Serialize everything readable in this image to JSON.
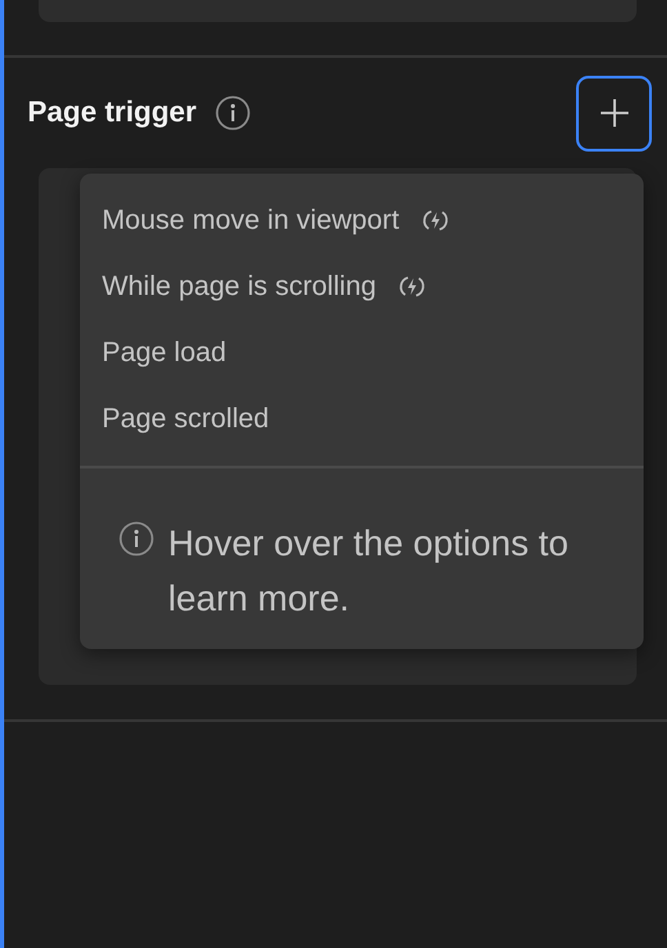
{
  "section": {
    "title": "Page trigger"
  },
  "menu": {
    "items": [
      {
        "label": "Mouse move in viewport",
        "kind": "continuous"
      },
      {
        "label": "While page is scrolling",
        "kind": "continuous"
      },
      {
        "label": "Page load",
        "kind": "plain"
      },
      {
        "label": "Page scrolled",
        "kind": "plain"
      }
    ],
    "hint": "Hover over the options to learn more."
  }
}
